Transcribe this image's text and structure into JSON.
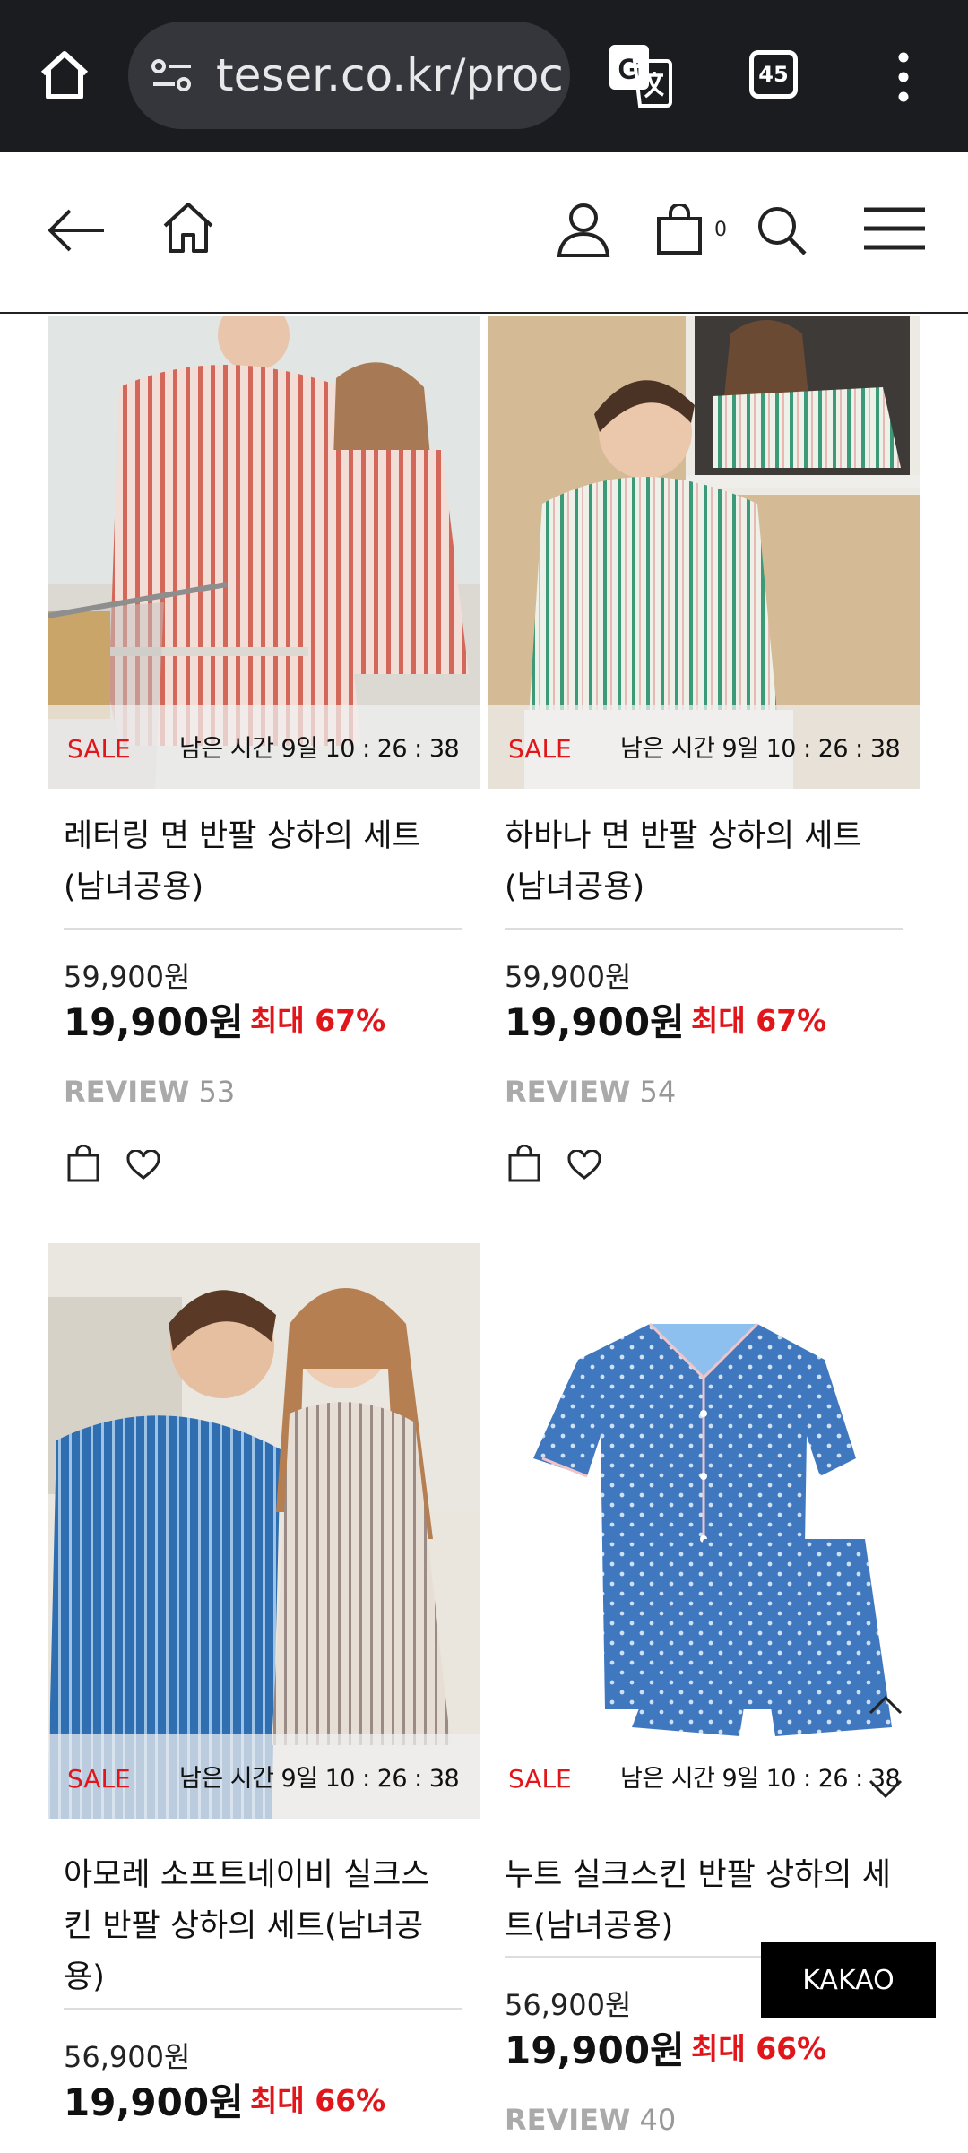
{
  "browser": {
    "url": "teser.co.kr/proc",
    "tab_count": "45"
  },
  "header": {
    "cart_count": "0"
  },
  "products": [
    {
      "badge": "SALE",
      "timer": "남은 시간 9일 10 : 26 : 38",
      "title_lines": [
        "레터링 면 반팔 상하의 세트",
        "(남녀공용)"
      ],
      "original_price": "59,900원",
      "price": "19,900원",
      "discount": "최대 67%",
      "review_label": "REVIEW",
      "review_count": "53"
    },
    {
      "badge": "SALE",
      "timer": "남은 시간 9일 10 : 26 : 38",
      "title_lines": [
        "하바나 면 반팔 상하의 세트",
        "(남녀공용)"
      ],
      "original_price": "59,900원",
      "price": "19,900원",
      "discount": "최대 67%",
      "review_label": "REVIEW",
      "review_count": "54"
    },
    {
      "badge": "SALE",
      "timer": "남은 시간 9일 10 : 26 : 38",
      "title_lines": [
        "아모레 소프트네이비 실크스",
        "킨 반팔 상하의 세트(남녀공",
        "용)"
      ],
      "original_price": "56,900원",
      "price": "19,900원",
      "discount": "최대 66%"
    },
    {
      "badge": "SALE",
      "timer": "남은 시간 9일 10 : 26 : 38",
      "title_lines": [
        "누트 실크스킨 반팔 상하의 세",
        "트(남녀공용)"
      ],
      "original_price": "56,900원",
      "price": "19,900원",
      "discount": "최대 66%",
      "review_label": "REVIEW",
      "review_count": "40"
    }
  ],
  "kakao_label": "KAKAO",
  "colors": {
    "sale_red": "#e0161b",
    "chrome_bg": "#1b1c20"
  }
}
